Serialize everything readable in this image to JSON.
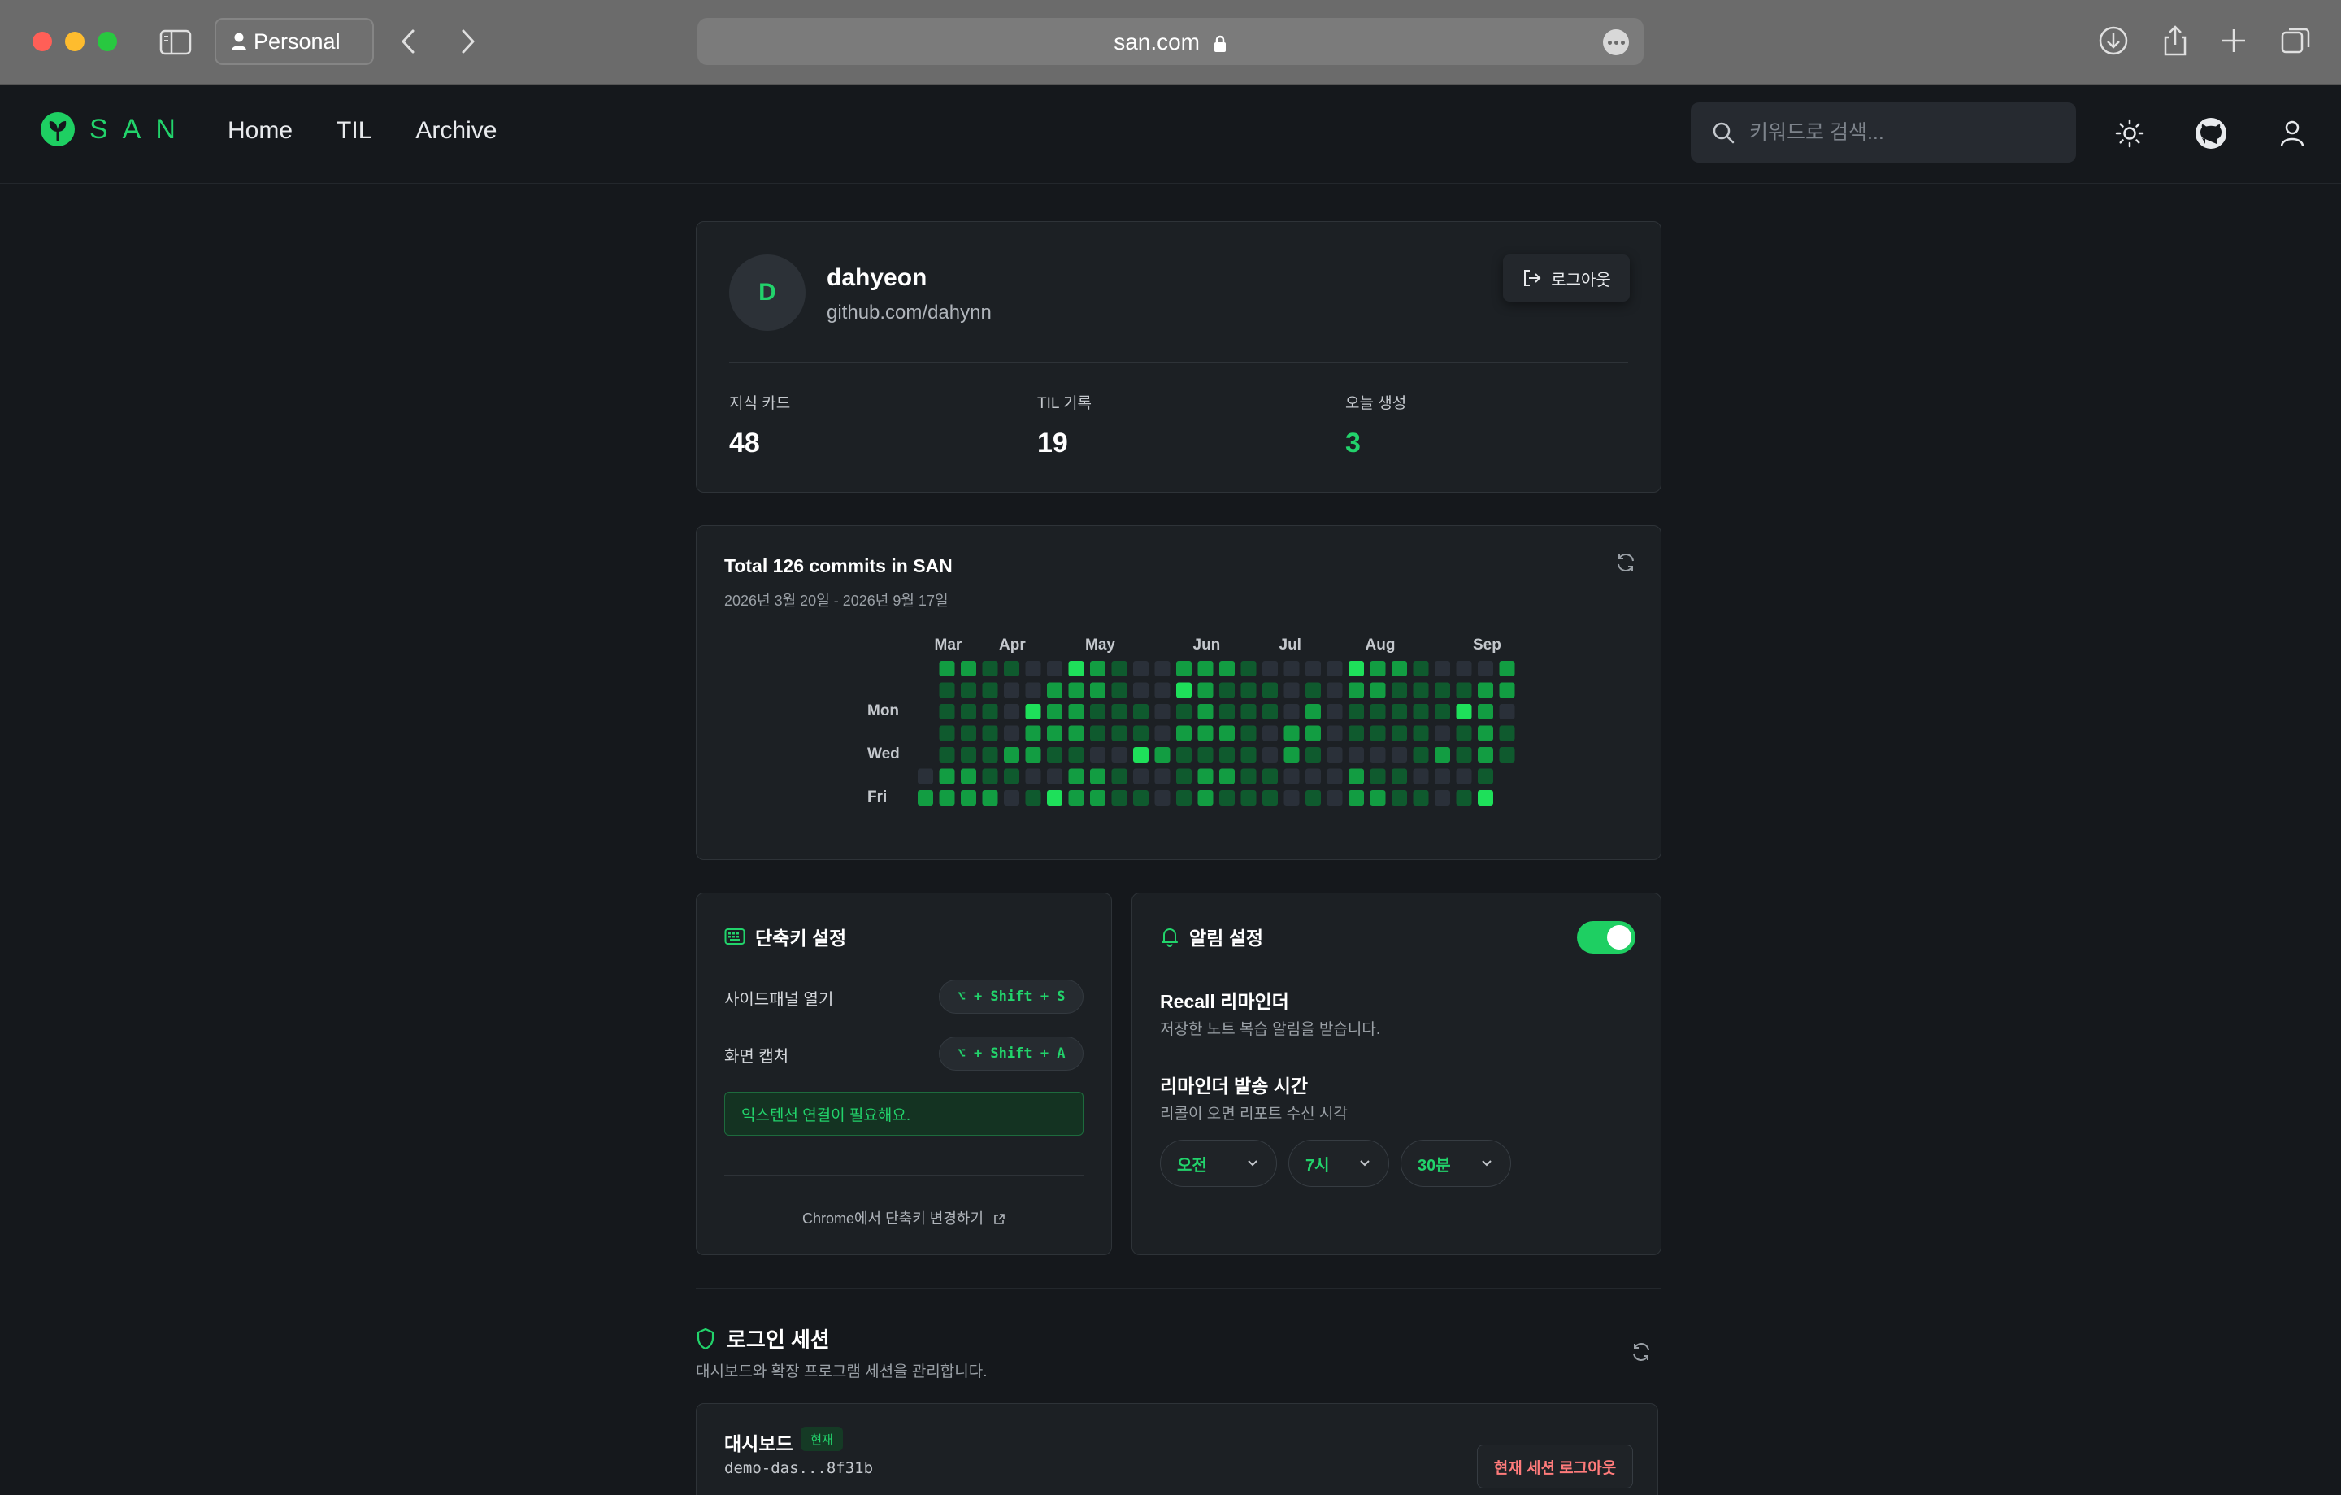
{
  "browser": {
    "profile": "Personal",
    "url": "san.com"
  },
  "site": {
    "logo_text": "SAN",
    "nav": [
      {
        "label": "Home"
      },
      {
        "label": "TIL"
      },
      {
        "label": "Archive"
      }
    ],
    "search_placeholder": "키워드로 검색..."
  },
  "profile": {
    "avatar_letter": "D",
    "name": "dahyeon",
    "link": "github.com/dahynn",
    "logout_label": "로그아웃",
    "stats": [
      {
        "label": "지식 카드",
        "value": "48"
      },
      {
        "label": "TIL 기록",
        "value": "19"
      },
      {
        "label": "오늘 생성",
        "value": "3"
      }
    ]
  },
  "commits": {
    "title": "Total 126 commits in SAN",
    "range": "2026년 3월 20일 - 2026년 9월 17일",
    "months": [
      "Mar",
      "Apr",
      "May",
      "Jun",
      "Jul",
      "Aug",
      "Sep"
    ],
    "days": [
      "Mon",
      "Wed",
      "Fri"
    ],
    "colors": [
      "#2a3039",
      "#0f5a2e",
      "#129d42",
      "#1ee05a"
    ],
    "weeks": [
      [
        null,
        null,
        null,
        null,
        null,
        0,
        2
      ],
      [
        2,
        1,
        1,
        1,
        1,
        2,
        2
      ],
      [
        2,
        1,
        1,
        1,
        1,
        2,
        2
      ],
      [
        1,
        1,
        1,
        1,
        1,
        1,
        2
      ],
      [
        1,
        0,
        0,
        0,
        2,
        1,
        0
      ],
      [
        0,
        0,
        3,
        2,
        2,
        0,
        1
      ],
      [
        0,
        2,
        2,
        2,
        1,
        0,
        3
      ],
      [
        3,
        2,
        2,
        2,
        1,
        2,
        2
      ],
      [
        2,
        2,
        1,
        1,
        0,
        2,
        2
      ],
      [
        1,
        1,
        1,
        1,
        0,
        1,
        1
      ],
      [
        0,
        0,
        1,
        1,
        3,
        0,
        1
      ],
      [
        0,
        0,
        0,
        0,
        2,
        0,
        0
      ],
      [
        2,
        3,
        1,
        2,
        1,
        1,
        1
      ],
      [
        2,
        2,
        2,
        2,
        1,
        2,
        2
      ],
      [
        2,
        1,
        1,
        2,
        1,
        2,
        1
      ],
      [
        1,
        1,
        1,
        1,
        1,
        1,
        1
      ],
      [
        0,
        1,
        1,
        0,
        0,
        1,
        1
      ],
      [
        0,
        0,
        0,
        2,
        2,
        0,
        0
      ],
      [
        0,
        1,
        2,
        2,
        1,
        0,
        1
      ],
      [
        0,
        0,
        0,
        0,
        0,
        0,
        0
      ],
      [
        3,
        2,
        1,
        1,
        0,
        2,
        2
      ],
      [
        2,
        2,
        1,
        1,
        0,
        1,
        2
      ],
      [
        2,
        1,
        1,
        1,
        0,
        1,
        1
      ],
      [
        1,
        1,
        1,
        1,
        1,
        0,
        1
      ],
      [
        0,
        1,
        1,
        0,
        2,
        0,
        0
      ],
      [
        0,
        1,
        3,
        1,
        1,
        0,
        1
      ],
      [
        0,
        2,
        2,
        2,
        2,
        1,
        3
      ],
      [
        2,
        2,
        0,
        1,
        1,
        null,
        null
      ]
    ]
  },
  "shortcuts": {
    "title": "단축키 설정",
    "rows": [
      {
        "label": "사이드패널 열기",
        "keys": "⌥ + Shift + S"
      },
      {
        "label": "화면 캡처",
        "keys": "⌥ + Shift + A"
      }
    ],
    "warning": "익스텐션 연결이 필요해요.",
    "link": "Chrome에서 단축키 변경하기"
  },
  "notifications": {
    "title": "알림 설정",
    "enabled": true,
    "recall_title": "Recall 리마인더",
    "recall_desc": "저장한 노트 복습 알림을 받습니다.",
    "time_title": "리마인더 발송 시간",
    "time_desc": "리콜이 오면 리포트 수신 시각",
    "ampm": "오전",
    "hour": "7시",
    "minute": "30분"
  },
  "sessions": {
    "title": "로그인 세션",
    "desc": "대시보드와 확장 프로그램 세션을 관리합니다.",
    "items": [
      {
        "name": "대시보드",
        "badge": "현재",
        "id": "demo-das...8f31b",
        "action": "현재 세션 로그아웃"
      }
    ]
  }
}
